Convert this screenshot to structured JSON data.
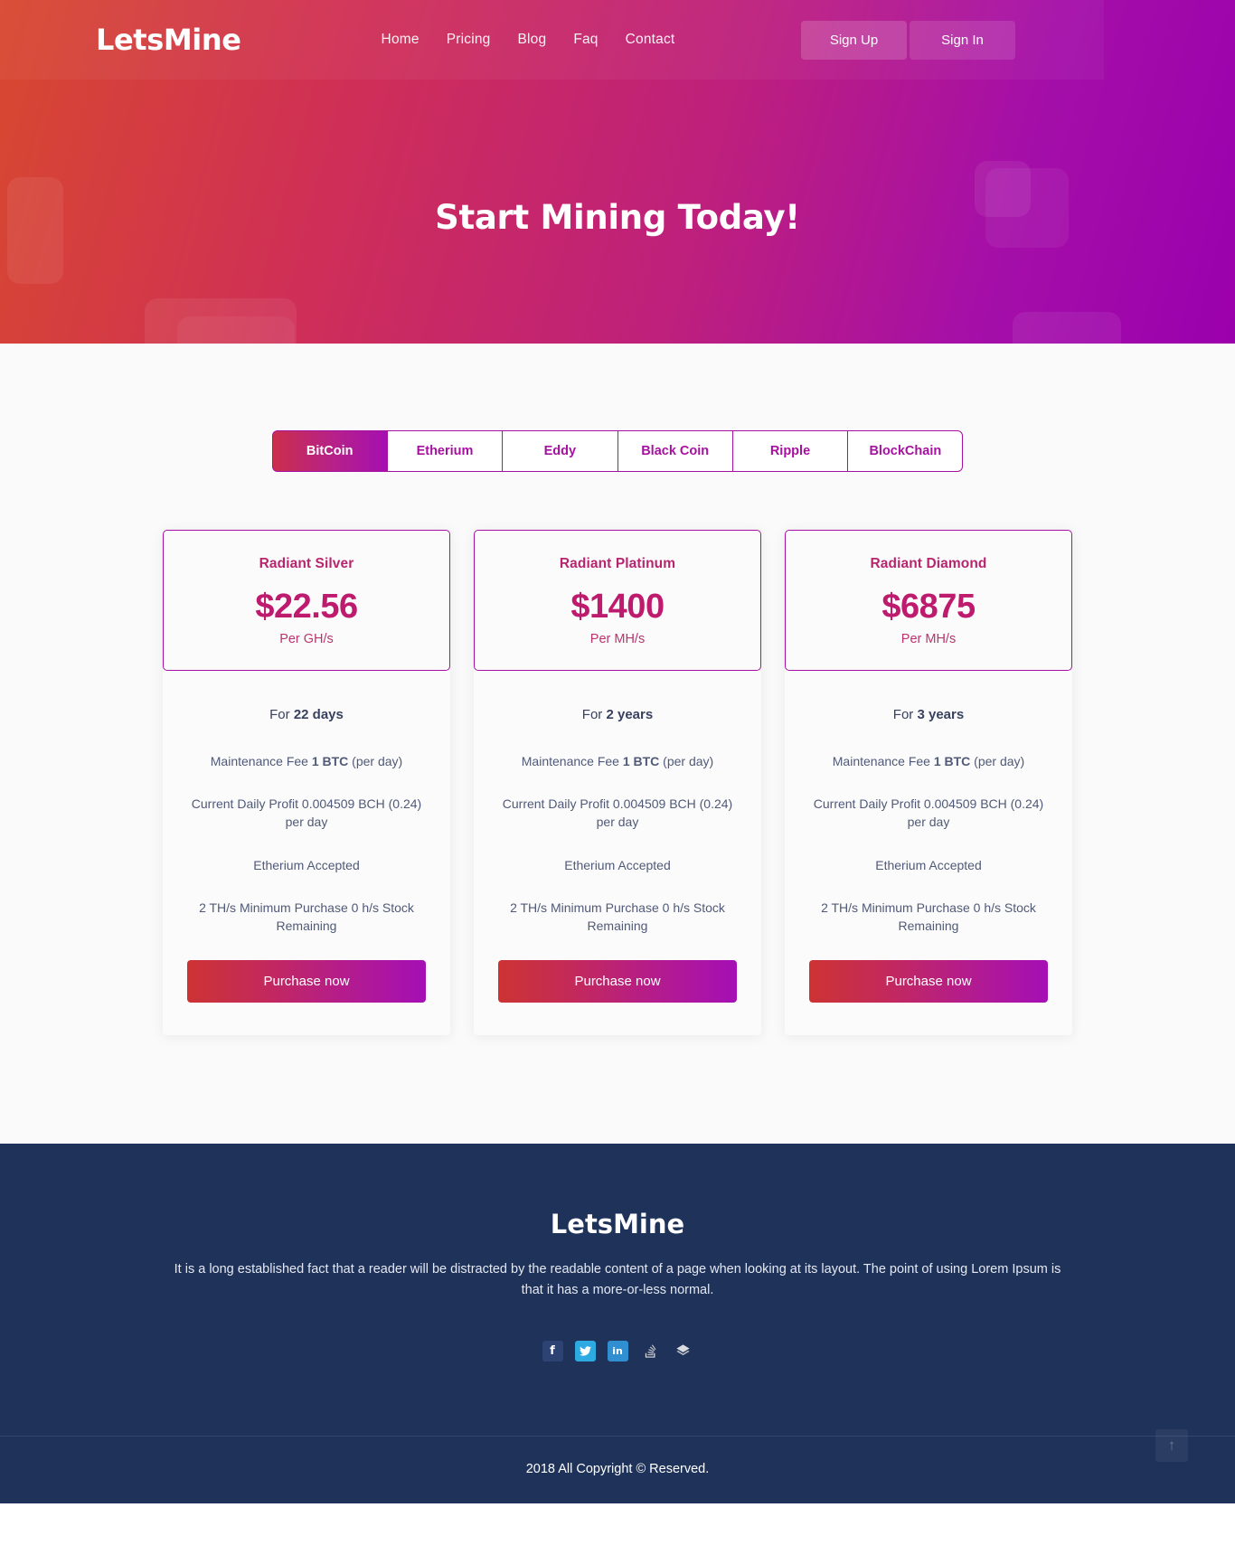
{
  "header": {
    "brand": "LetsMine",
    "nav": [
      {
        "label": "Home"
      },
      {
        "label": "Pricing"
      },
      {
        "label": "Blog"
      },
      {
        "label": "Faq"
      },
      {
        "label": "Contact"
      }
    ],
    "sign_up": "Sign Up",
    "sign_in": "Sign In"
  },
  "hero": {
    "title": "Start Mining Today!"
  },
  "pricing": {
    "tabs": [
      {
        "label": "BitCoin",
        "active": true
      },
      {
        "label": "Etherium",
        "active": false
      },
      {
        "label": "Eddy",
        "active": false
      },
      {
        "label": "Black Coin",
        "active": false
      },
      {
        "label": "Ripple",
        "active": false
      },
      {
        "label": "BlockChain",
        "active": false
      }
    ],
    "cards": [
      {
        "name": "Radiant Silver",
        "price": "$22.56",
        "unit": "Per GH/s",
        "duration_prefix": "For ",
        "duration_value": "22 days",
        "fee_prefix": "Maintenance Fee ",
        "fee_value": "1 BTC",
        "fee_suffix": " (per day)",
        "profit": "Current Daily Profit 0.004509 BCH (0.24) per day",
        "accepted": "Etherium Accepted",
        "stock": "2 TH/s Minimum Purchase 0 h/s Stock Remaining",
        "cta": "Purchase now"
      },
      {
        "name": "Radiant Platinum",
        "price": "$1400",
        "unit": "Per MH/s",
        "duration_prefix": "For ",
        "duration_value": "2 years",
        "fee_prefix": "Maintenance Fee ",
        "fee_value": "1 BTC",
        "fee_suffix": " (per day)",
        "profit": "Current Daily Profit 0.004509 BCH (0.24) per day",
        "accepted": "Etherium Accepted",
        "stock": "2 TH/s Minimum Purchase 0 h/s Stock Remaining",
        "cta": "Purchase now"
      },
      {
        "name": "Radiant Diamond",
        "price": "$6875",
        "unit": "Per MH/s",
        "duration_prefix": "For ",
        "duration_value": "3 years",
        "fee_prefix": "Maintenance Fee ",
        "fee_value": "1 BTC",
        "fee_suffix": " (per day)",
        "profit": "Current Daily Profit 0.004509 BCH (0.24) per day",
        "accepted": "Etherium Accepted",
        "stock": "2 TH/s Minimum Purchase 0 h/s Stock Remaining",
        "cta": "Purchase now"
      }
    ]
  },
  "footer": {
    "brand": "LetsMine",
    "description": "It is a long established fact that a reader will be distracted by the readable content of a page when looking at its layout. The point of using Lorem Ipsum is that it has a more-or-less normal.",
    "socials": [
      {
        "icon": "facebook-icon",
        "glyph": "f",
        "color": "#2d4373"
      },
      {
        "icon": "twitter-icon",
        "glyph": "✉",
        "color": "#2daae1"
      },
      {
        "icon": "linkedin-icon",
        "glyph": "in",
        "color": "#2f8fd0"
      },
      {
        "icon": "stack-overflow-icon",
        "glyph": "≣",
        "color": "#d8d8d8"
      },
      {
        "icon": "dribbble-icon",
        "glyph": "◆",
        "color": "#d8d8d8"
      }
    ],
    "back_to_top": "↑",
    "copyright": "2018 All Copyright © Reserved."
  },
  "colors": {
    "gradient_start": "#d8482f",
    "gradient_end": "#9b00ad",
    "accent": "#a5129f",
    "price": "#bf1b6e",
    "footer_bg": "#1f3259"
  }
}
